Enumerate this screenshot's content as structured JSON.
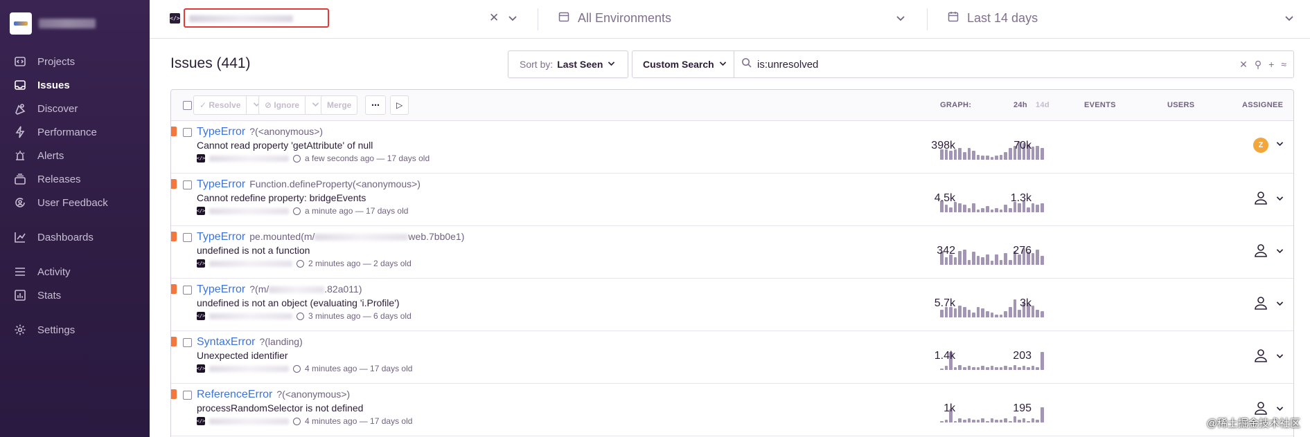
{
  "sidebar": {
    "items": [
      {
        "label": "Projects",
        "icon": "projects-icon"
      },
      {
        "label": "Issues",
        "icon": "issues-icon",
        "active": true
      },
      {
        "label": "Discover",
        "icon": "discover-icon"
      },
      {
        "label": "Performance",
        "icon": "performance-icon"
      },
      {
        "label": "Alerts",
        "icon": "alerts-icon"
      },
      {
        "label": "Releases",
        "icon": "releases-icon"
      },
      {
        "label": "User Feedback",
        "icon": "user-feedback-icon"
      },
      {
        "label": "Dashboards",
        "icon": "dashboards-icon"
      },
      {
        "label": "Activity",
        "icon": "activity-icon"
      },
      {
        "label": "Stats",
        "icon": "stats-icon"
      },
      {
        "label": "Settings",
        "icon": "settings-icon"
      }
    ]
  },
  "topbar": {
    "environment": "All Environments",
    "date_range": "Last 14 days",
    "clear_symbol": "✕"
  },
  "header": {
    "title": "Issues (441)",
    "sort_prefix": "Sort by:",
    "sort_value": "Last Seen",
    "custom_search": "Custom Search",
    "search_value": "is:unresolved"
  },
  "table": {
    "actions": {
      "resolve": "✓ Resolve",
      "ignore": "⊘ Ignore",
      "merge": "Merge",
      "more": "⋯",
      "play": "▷"
    },
    "columns": {
      "graph": "GRAPH:",
      "period_24h": "24h",
      "period_14d": "14d",
      "events": "EVENTS",
      "users": "USERS",
      "assignee": "ASSIGNEE"
    },
    "rows": [
      {
        "type": "TypeError",
        "culprit": "?(<anonymous>)",
        "message": "Cannot read property 'getAttribute' of null",
        "time": "a few seconds ago — 17 days old",
        "events": "398k",
        "users": "70k",
        "assignee": "Z",
        "graph": [
          8,
          8,
          7,
          8,
          9,
          6,
          9,
          7,
          4,
          3,
          3,
          2,
          3,
          4,
          6,
          9,
          11,
          14,
          13,
          12,
          10,
          11,
          9
        ]
      },
      {
        "type": "TypeError",
        "culprit": "Function.defineProperty(<anonymous>)",
        "message": "Cannot redefine property: bridgeEvents",
        "time": "a minute ago — 17 days old",
        "events": "4.5k",
        "users": "1.3k",
        "assignee": "",
        "graph": [
          9,
          6,
          4,
          8,
          7,
          6,
          3,
          7,
          2,
          3,
          5,
          2,
          3,
          2,
          6,
          3,
          8,
          7,
          9,
          4,
          7,
          6,
          7
        ]
      },
      {
        "type": "TypeError",
        "culprit": "pe.mounted(m/",
        "culprit_tail": "web.7bb0e1)",
        "message": "undefined is not a function",
        "time": "2 minutes ago — 2 days old",
        "events": "342",
        "users": "276",
        "assignee": "",
        "graph": [
          10,
          6,
          8,
          6,
          11,
          12,
          4,
          10,
          7,
          6,
          8,
          3,
          8,
          4,
          9,
          4,
          11,
          8,
          13,
          10,
          9,
          12,
          7
        ]
      },
      {
        "type": "TypeError",
        "culprit": "?(m/",
        "culprit_tail": ".82a011)",
        "message": "undefined is not an object (evaluating 'i.Profile')",
        "time": "3 minutes ago — 6 days old",
        "events": "5.7k",
        "users": "3k",
        "assignee": "",
        "graph": [
          6,
          8,
          8,
          7,
          9,
          8,
          6,
          4,
          8,
          7,
          5,
          4,
          2,
          2,
          5,
          8,
          14,
          6,
          12,
          10,
          9,
          6,
          5
        ]
      },
      {
        "type": "SyntaxError",
        "culprit": "?(landing)",
        "message": "Unexpected identifier",
        "time": "4 minutes ago — 17 days old",
        "events": "1.4k",
        "users": "203",
        "assignee": "",
        "graph": [
          1,
          3,
          14,
          2,
          4,
          2,
          3,
          2,
          2,
          3,
          2,
          3,
          2,
          2,
          3,
          2,
          4,
          2,
          3,
          2,
          3,
          2,
          14
        ]
      },
      {
        "type": "ReferenceError",
        "culprit": "?(<anonymous>)",
        "message": "processRandomSelector is not defined",
        "time": "4 minutes ago — 17 days old",
        "events": "1k",
        "users": "195",
        "assignee": "",
        "graph": [
          1,
          2,
          10,
          1,
          3,
          2,
          3,
          2,
          2,
          3,
          1,
          3,
          2,
          2,
          3,
          1,
          5,
          2,
          3,
          1,
          3,
          2,
          12
        ]
      }
    ]
  },
  "watermark": "@稀土掘金技术社区",
  "colors": {
    "sidebar_bg": "#3a2452",
    "accent_link": "#3d74db",
    "level_error": "#f4773e",
    "graph_bar": "#a396b5",
    "highlight_box": "#e53935",
    "avatar": "#f3a63b"
  }
}
